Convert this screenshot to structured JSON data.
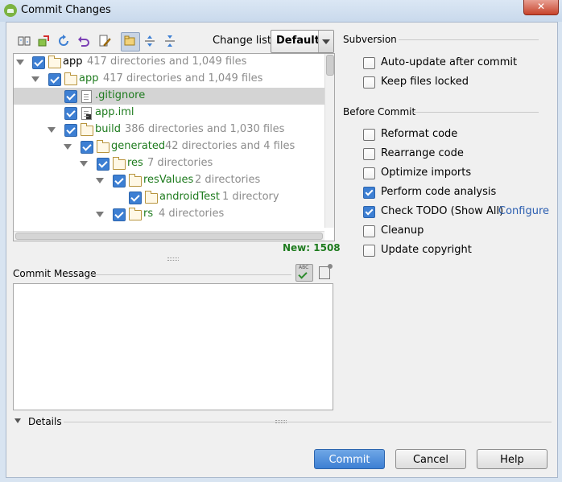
{
  "window": {
    "title": "Commit Changes",
    "close_label": "✕"
  },
  "toolbar": {
    "icons": [
      "vcs-diff-icon",
      "move-to-changelist-icon",
      "refresh-icon",
      "rollback-icon",
      "edit-source-icon",
      "group-by-directory-icon",
      "expand-all-icon",
      "collapse-all-icon"
    ],
    "changelist_label": "Change list:",
    "changelist_value": "Default"
  },
  "tree": {
    "rows": [
      {
        "name": "app",
        "meta": "417 directories and 1,049 files",
        "kind": "module",
        "green": false
      },
      {
        "name": "app",
        "meta": "417 directories and 1,049 files",
        "kind": "folder",
        "green": true
      },
      {
        "name": ".gitignore",
        "meta": "",
        "kind": "file",
        "green": true
      },
      {
        "name": "app.iml",
        "meta": "",
        "kind": "iml",
        "green": true
      },
      {
        "name": "build",
        "meta": "386 directories and 1,030 files",
        "kind": "folder",
        "green": true
      },
      {
        "name": "generated",
        "meta": "42 directories and 4 files",
        "kind": "folder",
        "green": true
      },
      {
        "name": "res",
        "meta": "7 directories",
        "kind": "folder",
        "green": true
      },
      {
        "name": "resValues",
        "meta": "2 directories",
        "kind": "folder",
        "green": true
      },
      {
        "name": "androidTest",
        "meta": "1 directory",
        "kind": "folder",
        "green": true
      },
      {
        "name": "rs",
        "meta": "4 directories",
        "kind": "folder",
        "green": true
      }
    ],
    "new_count": "New: 1508"
  },
  "commit_message": {
    "label": "Commit Message",
    "value": "",
    "spell_abc": "ABC"
  },
  "details": {
    "label": "Details"
  },
  "subversion": {
    "title": "Subversion",
    "options": [
      {
        "label": "Auto-update after commit",
        "checked": false
      },
      {
        "label": "Keep files locked",
        "checked": false
      }
    ]
  },
  "before_commit": {
    "title": "Before Commit",
    "options": [
      {
        "label": "Reformat code",
        "checked": false
      },
      {
        "label": "Rearrange code",
        "checked": false
      },
      {
        "label": "Optimize imports",
        "checked": false
      },
      {
        "label": "Perform code analysis",
        "checked": true
      },
      {
        "label": "Check TODO (Show All)",
        "checked": true
      },
      {
        "label": "Cleanup",
        "checked": false
      },
      {
        "label": "Update copyright",
        "checked": false
      }
    ],
    "configure_link": "Configure"
  },
  "buttons": {
    "commit": "Commit",
    "cancel": "Cancel",
    "help": "Help"
  },
  "colors": {
    "accent": "#3d7fd3",
    "added_file": "#1e7b1e",
    "link": "#2a5db0"
  }
}
